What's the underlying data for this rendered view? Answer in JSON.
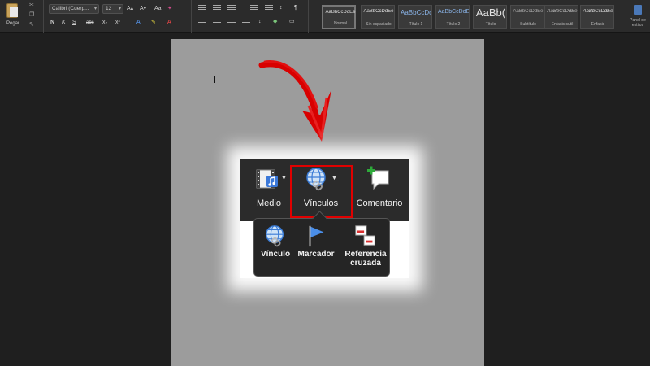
{
  "ribbon": {
    "paste_label": "Pegar",
    "font_name": "Calibri (Cuerp...",
    "font_size": "12",
    "format_buttons": [
      "N",
      "K",
      "S",
      "abc"
    ],
    "styles": [
      {
        "sample": "AaBbCcDdEe",
        "name": "Normal"
      },
      {
        "sample": "AaBbCcDdEe",
        "name": "Sin espaciado"
      },
      {
        "sample": "AaBbCcDc",
        "name": "Título 1"
      },
      {
        "sample": "AaBbCcDdE",
        "name": "Título 2"
      },
      {
        "sample": "AaBb(",
        "name": "Título"
      },
      {
        "sample": "AaBbCcDdEe",
        "name": "Subtítulo"
      },
      {
        "sample": "AaBbCcDdEe",
        "name": "Énfasis sutil"
      },
      {
        "sample": "AaBbCcDdEe",
        "name": "Énfasis"
      }
    ],
    "panel_label": "Panel de estilos"
  },
  "insert_toolbar": {
    "medio_label": "Medio",
    "vinculos_label": "Vínculos",
    "comentario_label": "Comentario"
  },
  "vinculos_menu": {
    "vinculo_label": "Vínculo",
    "marcador_label": "Marcador",
    "referencia_line1": "Referencia",
    "referencia_line2": "cruzada"
  },
  "colors": {
    "highlight": "#e00000",
    "arrow": "#d80000",
    "page": "#9c9c9c",
    "background": "#1f1f1f"
  }
}
